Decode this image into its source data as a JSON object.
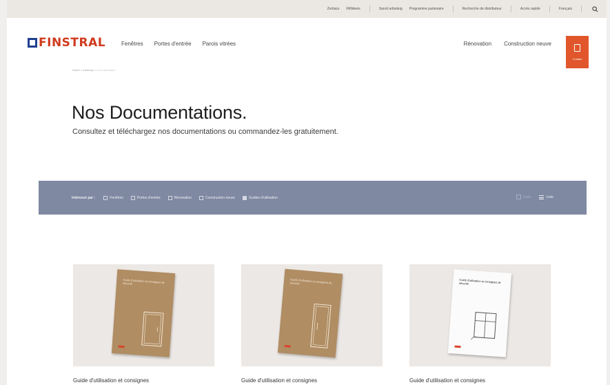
{
  "topbar": {
    "links": [
      "Zertiazs",
      "Rifildeeis",
      "Sanrd arttsdeig",
      "Programme partenaire",
      "Recherche de distributeur",
      "Accès rapide",
      "Français"
    ],
    "search_icon": "search-icon"
  },
  "header": {
    "logo_text": "FINSTRAL",
    "nav_left": [
      "Fenêtres",
      "Portes d'entrée",
      "Parois vitrées"
    ],
    "nav_right": [
      "Rénovation",
      "Construction neuve"
    ],
    "contact_label": "Contact"
  },
  "breadcrumb": {
    "items": [
      "Home",
      "Informaz"
    ],
    "current": "Documentation"
  },
  "main": {
    "title": "Nos Documentations.",
    "subtitle": "Consultez et téléchargez nos documentations ou commandez-les gratuitement."
  },
  "filters": {
    "label": "Intéressé par :",
    "options": [
      {
        "label": "Fenêtres",
        "checked": false
      },
      {
        "label": "Portes d'entrée",
        "checked": false
      },
      {
        "label": "Rénovation",
        "checked": false
      },
      {
        "label": "Construction neuve",
        "checked": false
      },
      {
        "label": "Guides d'utilisation",
        "checked": true
      }
    ],
    "view_grid": "Grille",
    "view_list": "Liste"
  },
  "cards": [
    {
      "title": "Guide d'utilisation et consignes",
      "cover_text": "Guide d'utilisation et consignes de sécurité",
      "cover_style": "kraft"
    },
    {
      "title": "Guide d'utilisation et consignes",
      "cover_text": "Guide d'utilisation et consignes de sécurité",
      "cover_style": "kraft"
    },
    {
      "title": "Guide d'utilisation et consignes",
      "cover_text": "Guide d'utilisation et consignes de sécurité",
      "cover_style": "white"
    }
  ],
  "colors": {
    "brand_orange": "#e1562b",
    "logo_blue": "#1f3f91",
    "filter_bar": "#7f89a1",
    "card_bg": "#ece8e6"
  }
}
